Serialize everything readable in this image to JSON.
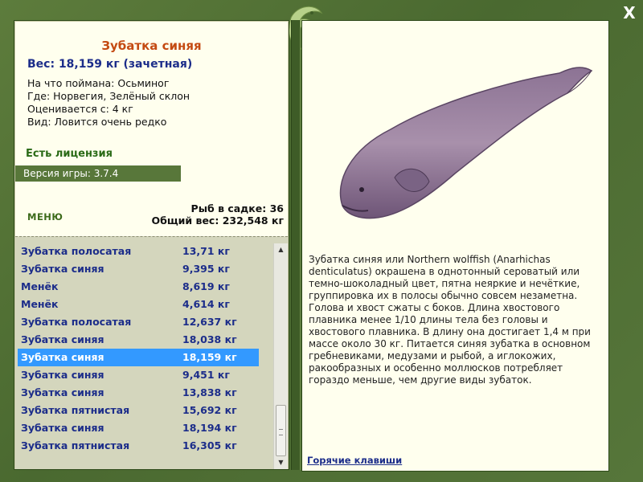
{
  "window": {
    "close_label": "X"
  },
  "fish": {
    "title": "Зубатка синяя",
    "weight": "Вес: 18,159 кг (зачетная)",
    "info": [
      "На что поймана: Осьминог",
      "Где: Норвегия, Зелёный склон",
      "Оценивается с: 4 кг",
      "Вид: Ловится очень редко"
    ],
    "license": "Есть лицензия",
    "version": "Версия игры: 3.7.4"
  },
  "menu": {
    "label": "МЕНЮ"
  },
  "stats": {
    "count": "Рыб в садке: 36",
    "total_weight": "Общий вес: 232,548 кг"
  },
  "catch_list": [
    {
      "name": "Зубатка полосатая",
      "weight": "13,71 кг"
    },
    {
      "name": "Зубатка синяя",
      "weight": "9,395 кг"
    },
    {
      "name": "Менёк",
      "weight": "8,619 кг"
    },
    {
      "name": "Менёк",
      "weight": "4,614 кг"
    },
    {
      "name": "Зубатка полосатая",
      "weight": "12,637 кг"
    },
    {
      "name": "Зубатка синяя",
      "weight": "18,038 кг"
    },
    {
      "name": "Зубатка синяя",
      "weight": "18,159 кг",
      "selected": true
    },
    {
      "name": "Зубатка синяя",
      "weight": "9,451 кг"
    },
    {
      "name": "Зубатка синяя",
      "weight": "13,838 кг"
    },
    {
      "name": "Зубатка пятнистая",
      "weight": "15,692 кг"
    },
    {
      "name": "Зубатка синяя",
      "weight": "18,194 кг"
    },
    {
      "name": "Зубатка пятнистая",
      "weight": "16,305 кг"
    }
  ],
  "description": "Зубатка синяя или Northern wolffish (Anarhichas denticulatus) окрашена в однотонный сероватый или темно-шоколадный цвет, пятна неяркие и нечёткие, группировка их в полосы обычно совсем незаметна. Голова и хвост сжаты с боков. Длина хвостового плавника менее 1/10 длины тела без головы и хвостового плавника. В длину она достигает 1,4 м при массе около 30 кг. Питается синяя зубатка в основном гребневиками, медузами и рыбой, а иглокожих, ракообразных и особенно моллюсков потребляет гораздо меньше, чем другие виды зубаток.",
  "hotkeys": {
    "label": "Горячие клавиши"
  },
  "colors": {
    "frame": "#4f6e34",
    "panel": "#ffffee",
    "list_bg": "#d4d6bd",
    "selected": "#3399ff",
    "title": "#c44a12",
    "text_blue": "#1c2d8a",
    "license_green": "#2a6a16"
  },
  "icons": {
    "close": "close-icon",
    "logo": "fish-logo-icon",
    "scroll_up": "scroll-up-arrow-icon",
    "scroll_down": "scroll-down-arrow-icon"
  }
}
